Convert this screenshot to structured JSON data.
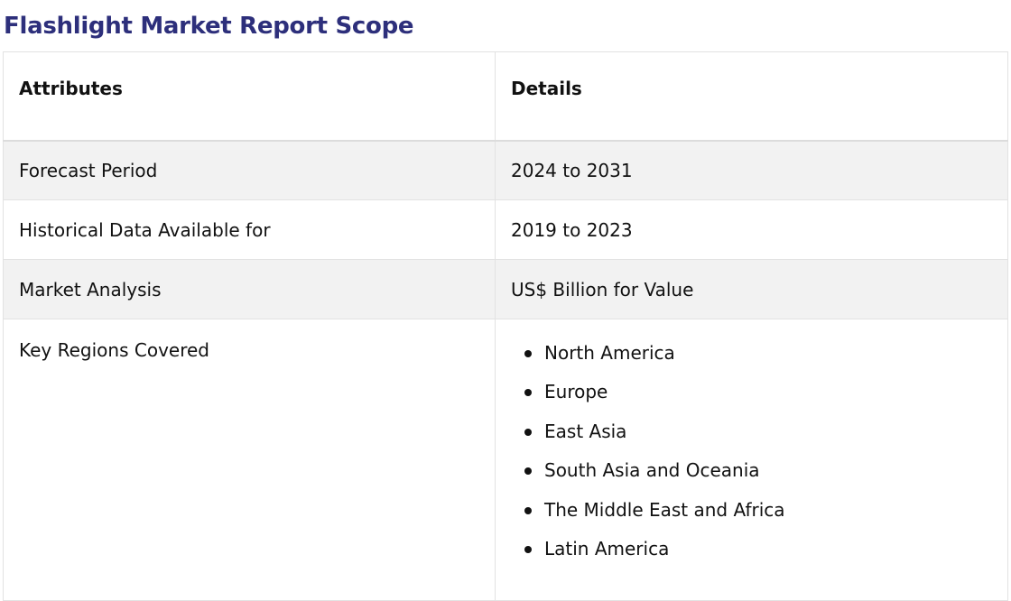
{
  "title": "Flashlight Market Report Scope",
  "table": {
    "headers": {
      "attribute": "Attributes",
      "details": "Details"
    },
    "rows": [
      {
        "attribute": "Forecast Period",
        "details": "2024 to 2031"
      },
      {
        "attribute": "Historical Data Available for",
        "details": "2019 to 2023"
      },
      {
        "attribute": "Market Analysis",
        "details": "US$ Billion for Value"
      }
    ],
    "regions": {
      "attribute": "Key Regions Covered",
      "items": [
        "North America",
        "Europe",
        "East Asia",
        "South Asia and Oceania",
        "The Middle East and Africa",
        "Latin America"
      ]
    }
  }
}
